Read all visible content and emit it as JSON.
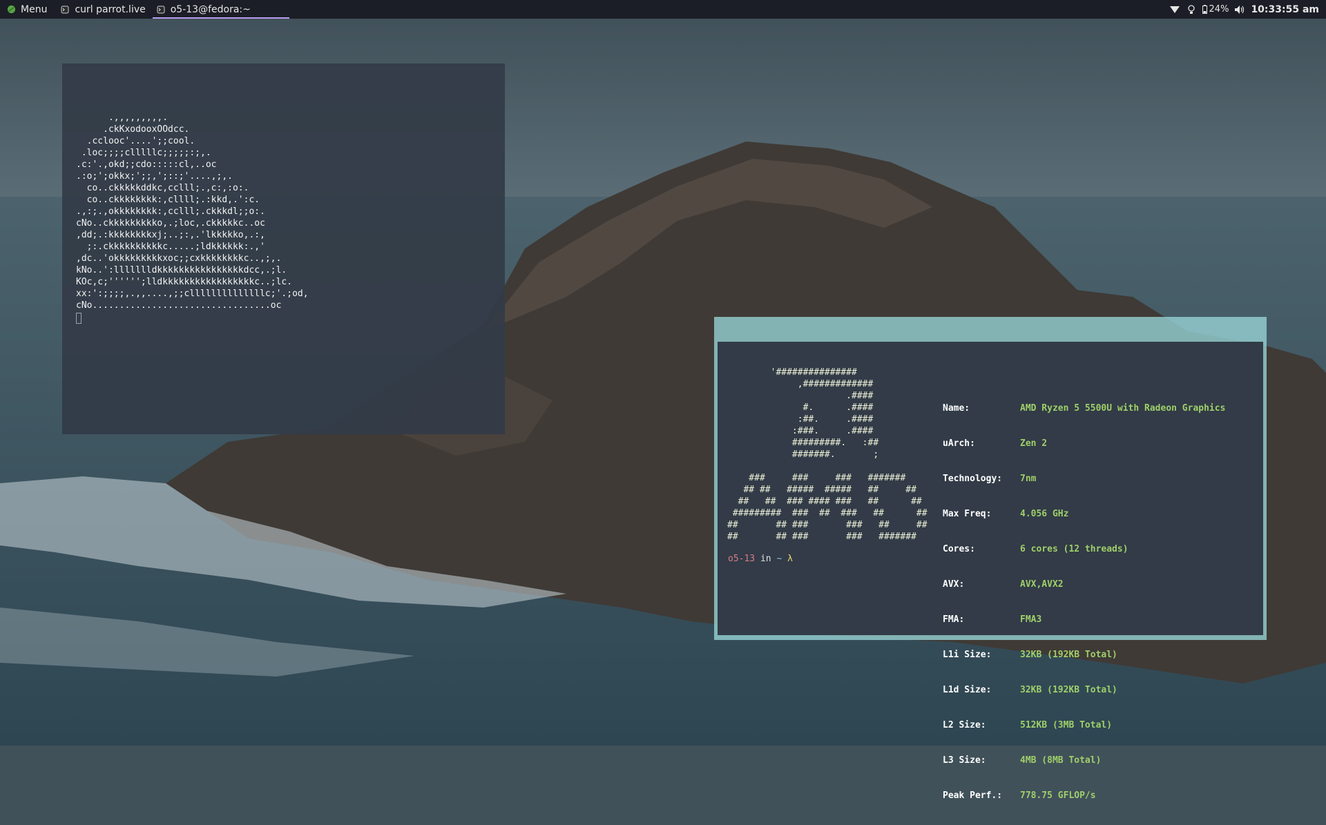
{
  "taskbar": {
    "menu_label": "Menu",
    "tasks": [
      {
        "label": "curl parrot.live",
        "active": false
      },
      {
        "label": "o5-13@fedora:~",
        "active": true
      }
    ],
    "tray": {
      "battery": "24%",
      "clock": "10:33:55 am"
    },
    "accent": "#b79bf0"
  },
  "terminal_parrot": {
    "art": "      .,,,,,,,,,.\n     .ckKxodooxOOdcc.\n  .cclooc'....';;cool.\n .loc;;;;clllllc;;;;;:;,.\n.c:'.,okd;;cdo:::::cl,..oc\n.:o;';okkx;';;,';::;'....,;,.\n  co..ckkkkkddkc,cclll;.,c:,:o:.\n  co..ckkkkkkkk:,cllll;.:kkd,.':c.\n.,:;.,okkkkkkkk:,cclll;.ckkkdl;;o:.\ncNo..ckkkkkkkkko,.;loc,.ckkkkkc..oc\n,dd;.:kkkkkkkkxj;..;:,.'lkkkkko,.:,\n  ;:.ckkkkkkkkkkc.....;ldkkkkkk:.,'\n,dc..'okkkkkkkkkxoc;;cxkkkkkkkkc..,;,.\nkNo..':llllllldkkkkkkkkkkkkkkkkdcc,.;l.\nKOc,c;'''''';lldkkkkkkkkkkkkkkkkkc..;lc.\nxx:':;;;;,.,,....,;;cllllllllllllllc;'.;od,\ncNo.................................oc"
  },
  "terminal_cpufetch": {
    "logo": "        '###############\n             ,#############\n                      .####\n              #.      .####\n             :##.     .####\n            :###.     .####\n            #########.   :##\n            #######.       ;\n\n    ###     ###     ###   #######\n   ## ##   #####  #####   ##     ##\n  ##   ##  ### #### ###   ##      ##\n #########  ###  ##  ###   ##      ##\n##       ## ###       ###   ##     ##\n##       ## ###       ###   #######",
    "info": [
      {
        "key": "Name:",
        "value": "AMD Ryzen 5 5500U with Radeon Graphics"
      },
      {
        "key": "uArch:",
        "value": "Zen 2"
      },
      {
        "key": "Technology:",
        "value": "7nm"
      },
      {
        "key": "Max Freq:",
        "value": "4.056 GHz"
      },
      {
        "key": "Cores:",
        "value": "6 cores (12 threads)"
      },
      {
        "key": "AVX:",
        "value": "AVX,AVX2"
      },
      {
        "key": "FMA:",
        "value": "FMA3"
      },
      {
        "key": "L1i Size:",
        "value": "32KB (192KB Total)"
      },
      {
        "key": "L1d Size:",
        "value": "32KB (192KB Total)"
      },
      {
        "key": "L2 Size:",
        "value": "512KB (3MB Total)"
      },
      {
        "key": "L3 Size:",
        "value": "4MB (8MB Total)"
      },
      {
        "key": "Peak Perf.:",
        "value": "778.75 GFLOP/s"
      }
    ],
    "prompt": {
      "user": "o5-13",
      "in": " in ",
      "dir": "~",
      "symbol": " λ"
    },
    "value_color": "#9fcf6a",
    "border_color": "#96d2d4"
  },
  "icons": [
    "menu-icon",
    "terminal-icon",
    "wifi-icon",
    "bulb-icon",
    "battery-icon",
    "volume-icon"
  ]
}
